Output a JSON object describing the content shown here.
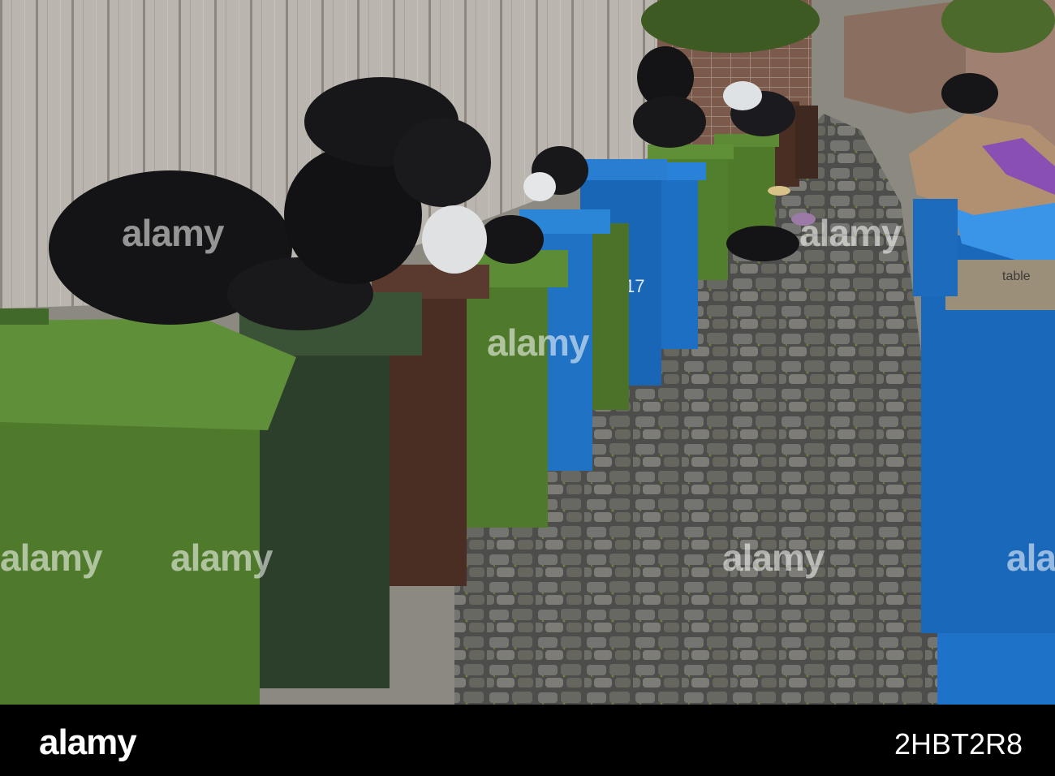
{
  "photo": {
    "subject": "",
    "bin_text": "17",
    "box_text": "table",
    "colors": {
      "green_bin": "#4f7a2c",
      "dark_green_bin": "#2c3f2a",
      "brown_bin": "#4a2e24",
      "blue_bin": "#1e73c8",
      "bag": "#141416",
      "fence": "#b9b4ad",
      "cobbles": "#6e6c67"
    }
  },
  "watermarks": [
    "alamy",
    "alamy",
    "alamy",
    "alamy",
    "alamy",
    "alamy",
    "alamy",
    "alamy",
    "alamy"
  ],
  "footer": {
    "logo": "alamy",
    "image_id": "2HBT2R8",
    "background": "#000000",
    "text_color": "#ffffff"
  }
}
